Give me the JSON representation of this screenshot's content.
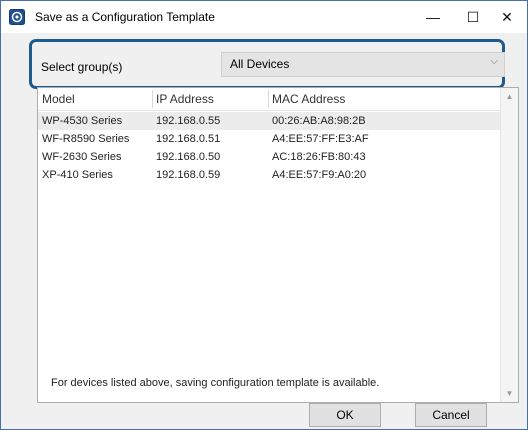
{
  "window": {
    "title": "Save as a Configuration Template",
    "minimize_glyph": "—",
    "maximize_glyph": "☐",
    "close_glyph": "✕"
  },
  "group_filter": {
    "label": "Select group(s)",
    "value": "All Devices"
  },
  "table": {
    "columns": [
      "Model",
      "IP Address",
      "MAC Address"
    ],
    "rows": [
      {
        "model": "WP-4530 Series",
        "ip": "192.168.0.55",
        "mac": "00:26:AB:A8:98:2B"
      },
      {
        "model": "WF-R8590 Series",
        "ip": "192.168.0.51",
        "mac": "A4:EE:57:FF:E3:AF"
      },
      {
        "model": "WF-2630 Series",
        "ip": "192.168.0.50",
        "mac": "AC:18:26:FB:80:43"
      },
      {
        "model": "XP-410 Series",
        "ip": "192.168.0.59",
        "mac": "A4:EE:57:F9:A0:20"
      }
    ]
  },
  "info_text": "For devices listed above, saving configuration template is available.",
  "buttons": {
    "ok": "OK",
    "cancel": "Cancel"
  },
  "icons": {
    "app": "printer-app-icon",
    "chevron": "chevron-down-icon",
    "scroll_up": "scroll-up-arrow-icon",
    "scroll_down": "scroll-down-arrow-icon"
  },
  "colors": {
    "highlight_border": "#1f5a8c",
    "dialog_bg": "#f0f0f0",
    "selected_row_bg": "#ececec"
  }
}
